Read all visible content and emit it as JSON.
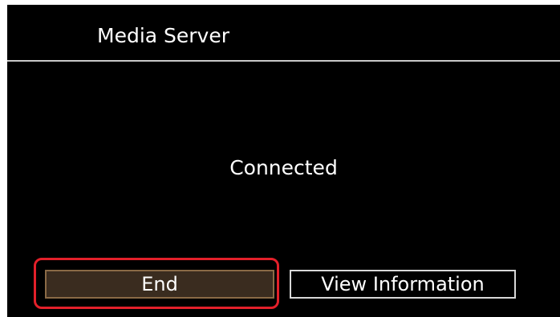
{
  "header": {
    "title": "Media Server"
  },
  "main": {
    "status": "Connected"
  },
  "actions": {
    "end_label": "End",
    "view_info_label": "View Information",
    "highlight_color": "#e3202a",
    "selected_button_color": "#3a2c1f"
  }
}
